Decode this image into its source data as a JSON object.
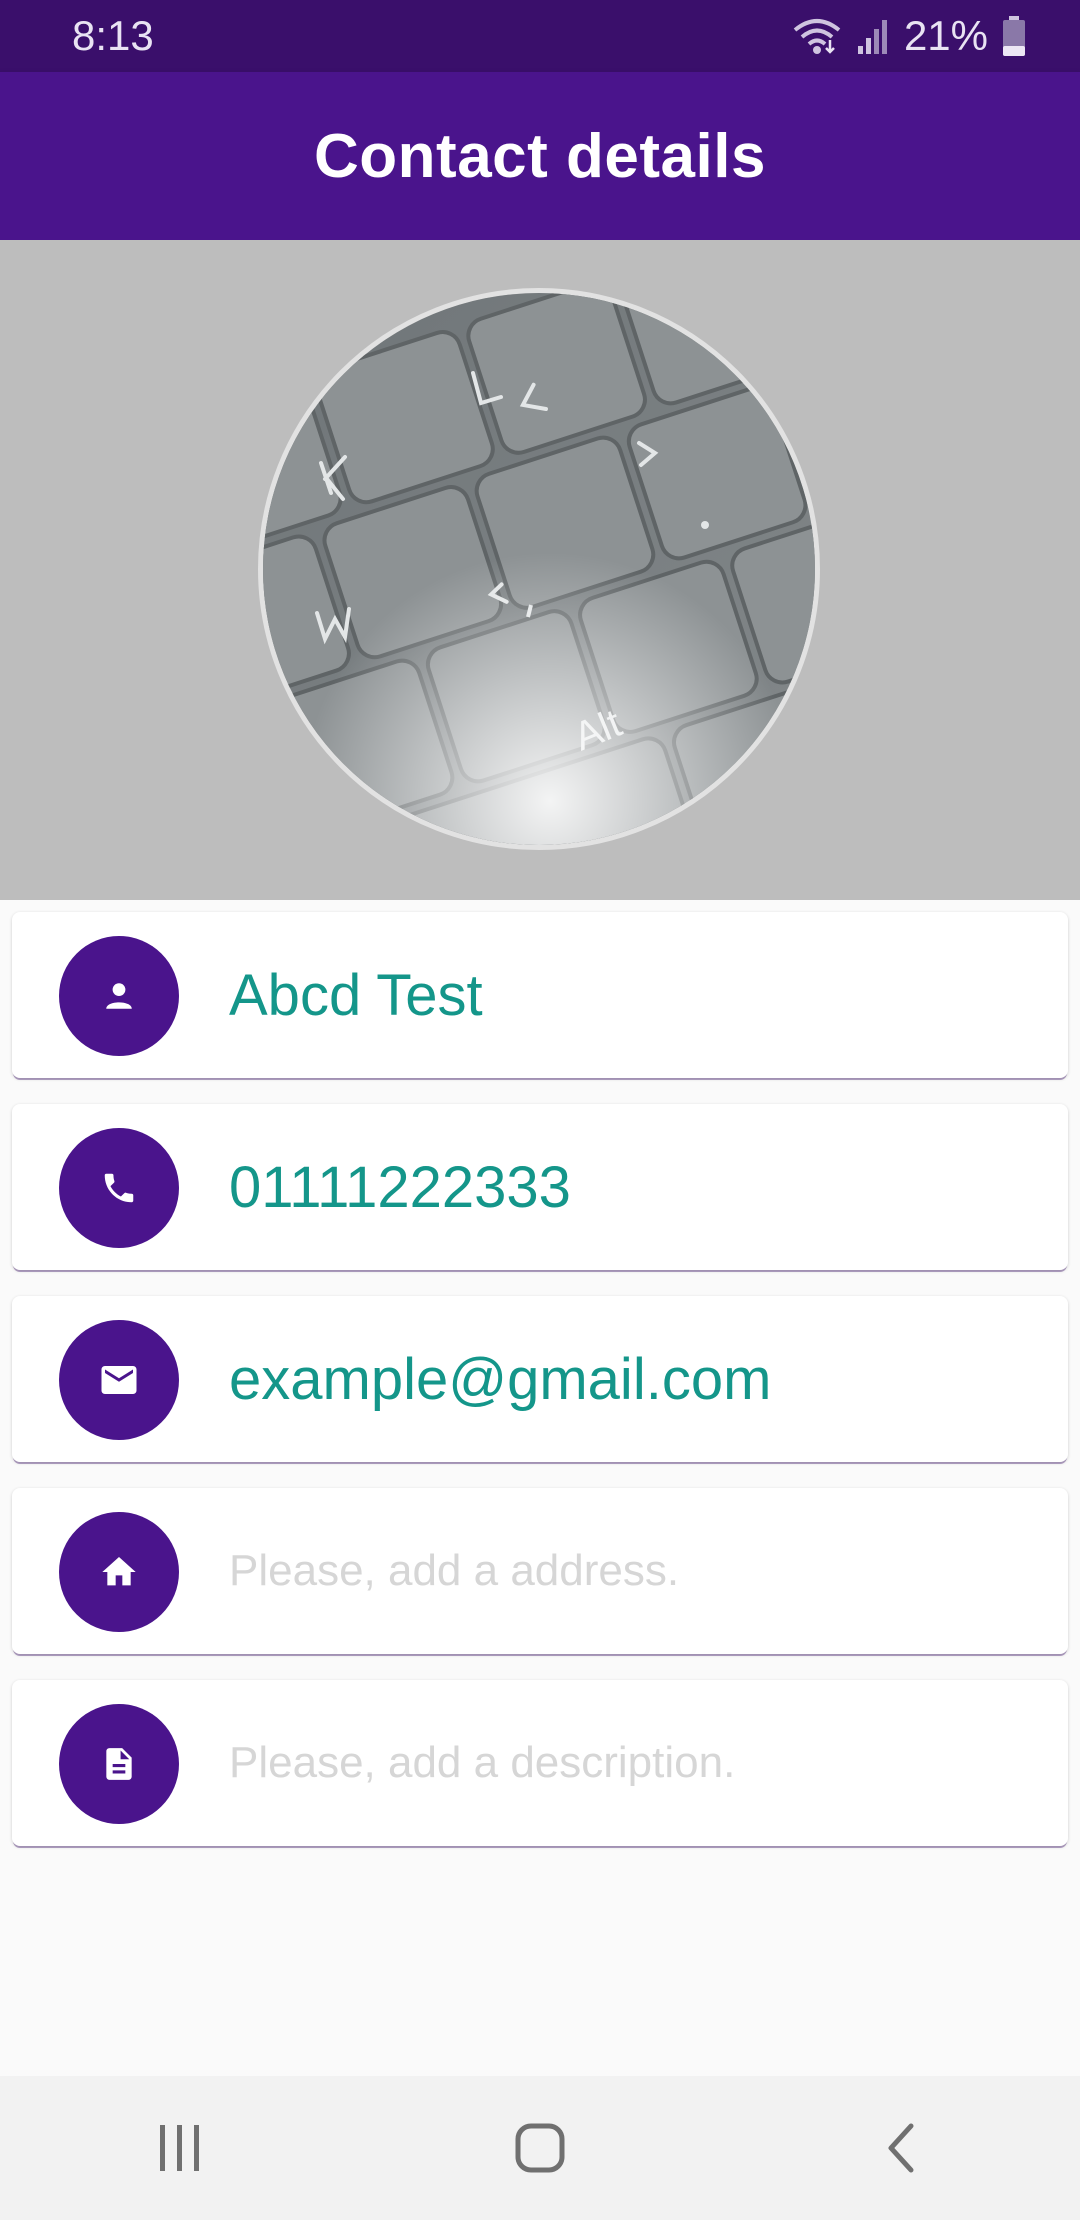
{
  "status_bar": {
    "time": "8:13",
    "battery": "21%",
    "icons": [
      "wifi-icon",
      "signal-icon",
      "battery-icon"
    ]
  },
  "app_bar": {
    "title": "Contact details"
  },
  "contact_photo": {
    "icon": "contact-photo"
  },
  "fields": [
    {
      "icon": "person-icon",
      "value": "Abcd Test"
    },
    {
      "icon": "phone-icon",
      "value": "01111222333"
    },
    {
      "icon": "mail-icon",
      "value": "example@gmail.com"
    },
    {
      "icon": "home-icon",
      "value": "",
      "placeholder": "Please, add a address."
    },
    {
      "icon": "description-icon",
      "value": "",
      "placeholder": "Please, add a description."
    }
  ],
  "nav_bar": {
    "icons": [
      "recent-apps-icon",
      "home-button-icon",
      "back-icon"
    ]
  },
  "colors": {
    "status_bar": "#3a0f6b",
    "primary": "#4a148c",
    "accent_text": "#14968a",
    "placeholder_text": "#d6d6d6",
    "photo_background": "#bdbdbd"
  }
}
